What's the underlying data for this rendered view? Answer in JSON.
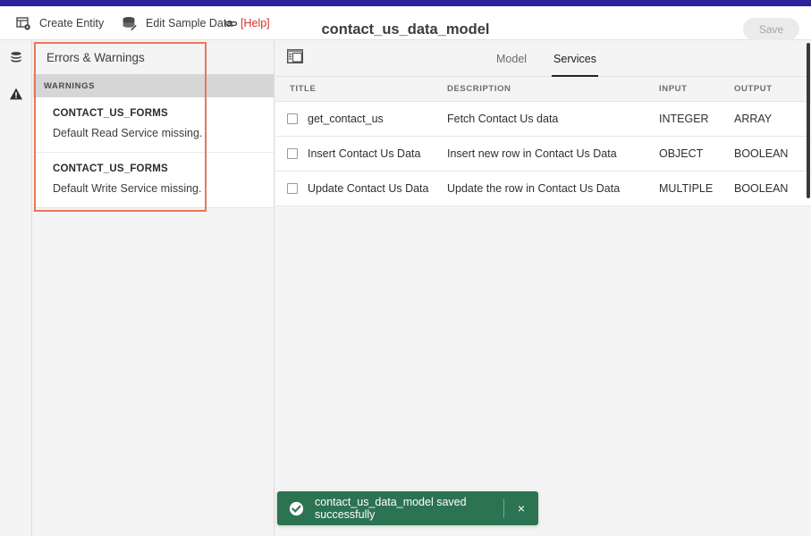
{
  "window": {
    "title": "contact_us_data_model",
    "accent_purple": "#2e219b",
    "annotation_color": "#e8785a"
  },
  "toolbar": {
    "create_entity_label": "Create Entity",
    "create_entity_icon": "entity-table-gear-icon",
    "edit_sample_data_label": "Edit Sample Data",
    "edit_sample_data_icon": "database-pencil-icon",
    "help_label": "[Help]",
    "help_icon": "link-icon",
    "help_color": "#d93025",
    "save_label": "Save",
    "save_disabled": true
  },
  "rail": {
    "items": [
      {
        "name": "database-icon",
        "label": "Data"
      },
      {
        "name": "warning-triangle-icon",
        "label": "Errors & Warnings"
      }
    ]
  },
  "warnings_panel": {
    "heading": "Errors & Warnings",
    "section_label": "WARNINGS",
    "items": [
      {
        "entity": "CONTACT_US_FORMS",
        "message": "Default Read Service missing."
      },
      {
        "entity": "CONTACT_US_FORMS",
        "message": "Default Write Service missing."
      }
    ]
  },
  "main": {
    "panel_toggle_icon": "sidebar-panel-icon",
    "tabs": [
      {
        "label": "Model",
        "active": false
      },
      {
        "label": "Services",
        "active": true
      }
    ],
    "table": {
      "columns": [
        "TITLE",
        "DESCRIPTION",
        "INPUT",
        "OUTPUT"
      ],
      "rows": [
        {
          "checked": false,
          "title": "get_contact_us",
          "description": "Fetch Contact Us data",
          "input": "INTEGER",
          "output": "ARRAY"
        },
        {
          "checked": false,
          "title": "Insert Contact Us Data",
          "description": "Insert new row in Contact Us Data",
          "input": "OBJECT",
          "output": "BOOLEAN"
        },
        {
          "checked": false,
          "title": "Update Contact Us Data",
          "description": "Update the row in Contact Us Data",
          "input": "MULTIPLE",
          "output": "BOOLEAN"
        }
      ]
    }
  },
  "toast": {
    "message": "contact_us_data_model saved successfully",
    "icon": "check-circle-icon",
    "close_label": "×",
    "background": "#2c7352"
  }
}
